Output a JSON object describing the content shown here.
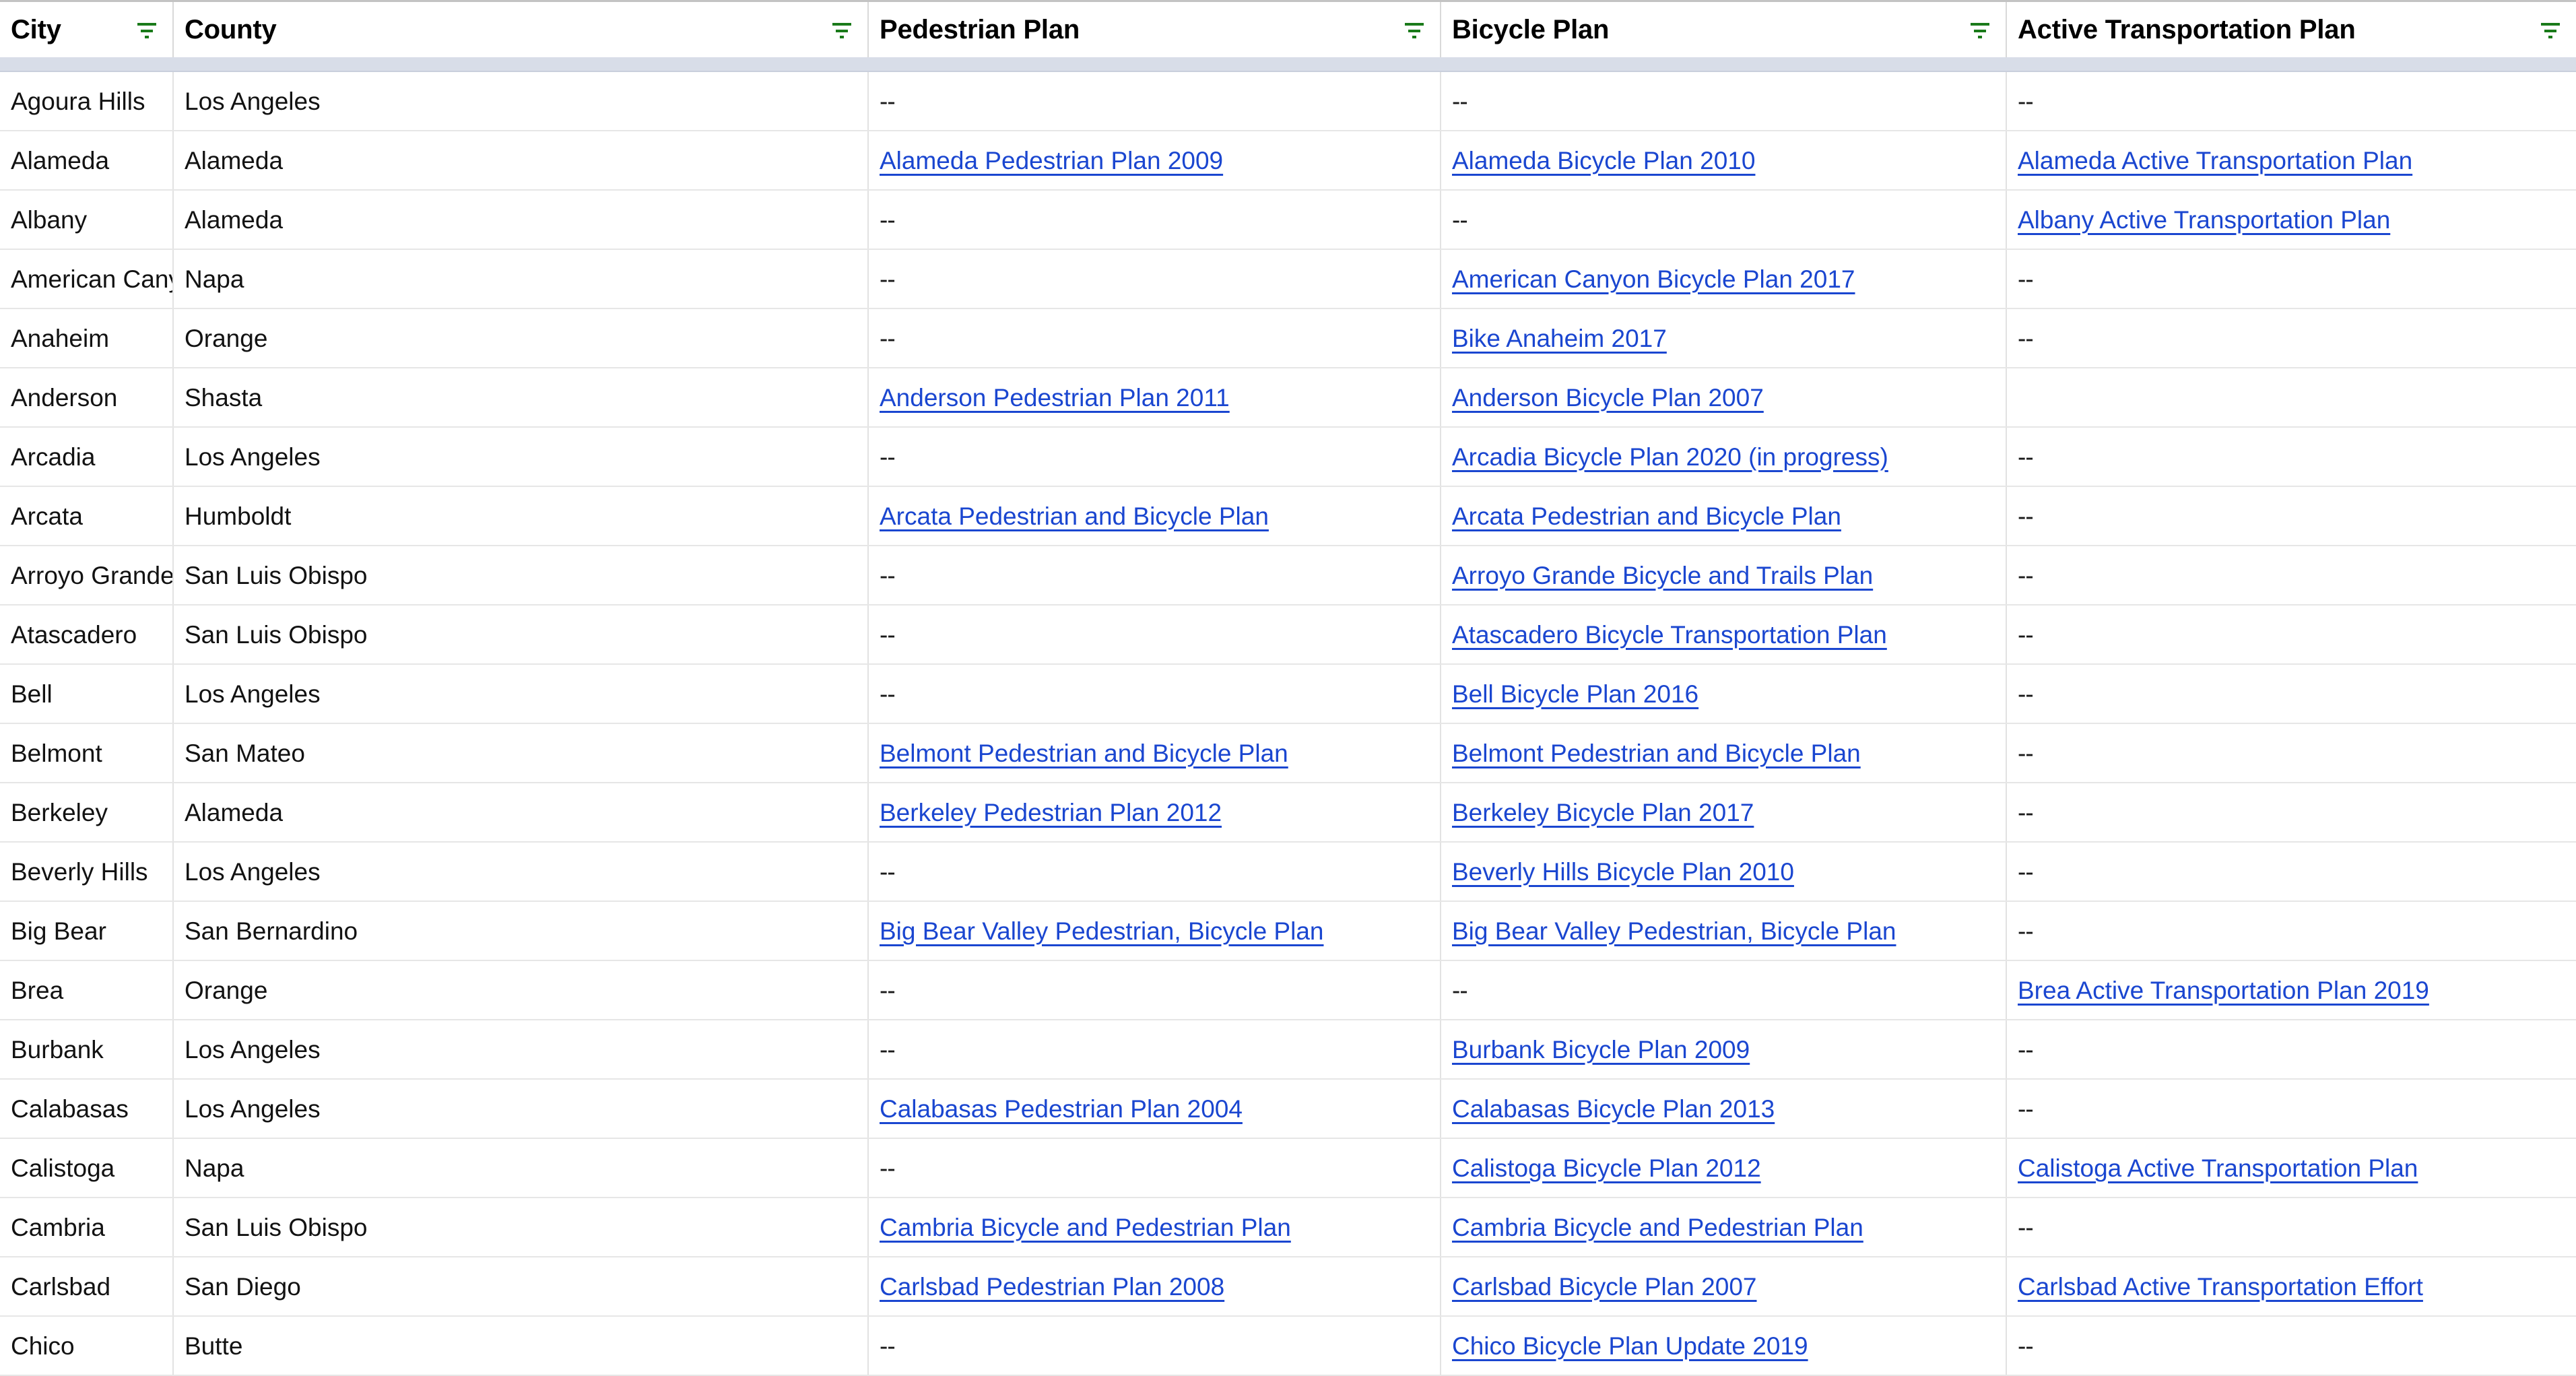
{
  "table": {
    "columns": [
      {
        "key": "city",
        "label": "City",
        "filter_icon": "filter-icon"
      },
      {
        "key": "county",
        "label": "County",
        "filter_icon": "filter-icon"
      },
      {
        "key": "ped",
        "label": "Pedestrian Plan",
        "filter_icon": "filter-icon"
      },
      {
        "key": "bike",
        "label": "Bicycle Plan",
        "filter_icon": "filter-icon"
      },
      {
        "key": "atp",
        "label": "Active Transportation Plan",
        "filter_icon": "filter-icon"
      }
    ],
    "empty_marker": "--",
    "link_color": "#1a46d0",
    "filter_icon_color": "#1a7a1a",
    "header_band_color": "#d8dde8",
    "rows": [
      {
        "city": "Agoura Hills",
        "county": "Los Angeles",
        "ped": {
          "text": "--",
          "link": false
        },
        "bike": {
          "text": "--",
          "link": false
        },
        "atp": {
          "text": "--",
          "link": false
        }
      },
      {
        "city": "Alameda",
        "county": "Alameda",
        "ped": {
          "text": "Alameda Pedestrian Plan 2009",
          "link": true
        },
        "bike": {
          "text": "Alameda Bicycle Plan 2010",
          "link": true
        },
        "atp": {
          "text": "Alameda Active Transportation Plan",
          "link": true
        }
      },
      {
        "city": "Albany",
        "county": "Alameda",
        "ped": {
          "text": "--",
          "link": false
        },
        "bike": {
          "text": "--",
          "link": false
        },
        "atp": {
          "text": "Albany Active Transportation Plan",
          "link": true
        }
      },
      {
        "city": "American Canyon",
        "county": "Napa",
        "ped": {
          "text": "--",
          "link": false
        },
        "bike": {
          "text": "American Canyon Bicycle Plan 2017",
          "link": true
        },
        "atp": {
          "text": "--",
          "link": false
        }
      },
      {
        "city": "Anaheim",
        "county": "Orange",
        "ped": {
          "text": "--",
          "link": false
        },
        "bike": {
          "text": "Bike Anaheim 2017",
          "link": true
        },
        "atp": {
          "text": "--",
          "link": false
        }
      },
      {
        "city": "Anderson",
        "county": "Shasta",
        "ped": {
          "text": "Anderson Pedestrian Plan 2011",
          "link": true
        },
        "bike": {
          "text": "Anderson Bicycle Plan 2007",
          "link": true
        },
        "atp": {
          "text": "",
          "link": false
        }
      },
      {
        "city": "Arcadia",
        "county": "Los Angeles",
        "ped": {
          "text": "--",
          "link": false
        },
        "bike": {
          "text": "Arcadia Bicycle Plan 2020 (in progress)",
          "link": true
        },
        "atp": {
          "text": "--",
          "link": false
        }
      },
      {
        "city": "Arcata",
        "county": "Humboldt",
        "ped": {
          "text": "Arcata Pedestrian and Bicycle Plan",
          "link": true
        },
        "bike": {
          "text": "Arcata Pedestrian and Bicycle Plan",
          "link": true
        },
        "atp": {
          "text": "--",
          "link": false
        }
      },
      {
        "city": "Arroyo Grande",
        "county": "San Luis Obispo",
        "ped": {
          "text": "--",
          "link": false
        },
        "bike": {
          "text": "Arroyo Grande Bicycle and Trails Plan",
          "link": true
        },
        "atp": {
          "text": "--",
          "link": false
        }
      },
      {
        "city": "Atascadero",
        "county": "San Luis Obispo",
        "ped": {
          "text": "--",
          "link": false
        },
        "bike": {
          "text": "Atascadero Bicycle Transportation Plan",
          "link": true
        },
        "atp": {
          "text": "--",
          "link": false
        }
      },
      {
        "city": "Bell",
        "county": "Los Angeles",
        "ped": {
          "text": "--",
          "link": false
        },
        "bike": {
          "text": "Bell Bicycle Plan 2016",
          "link": true
        },
        "atp": {
          "text": "--",
          "link": false
        }
      },
      {
        "city": "Belmont",
        "county": "San Mateo",
        "ped": {
          "text": "Belmont Pedestrian and Bicycle Plan",
          "link": true
        },
        "bike": {
          "text": "Belmont Pedestrian and Bicycle Plan",
          "link": true
        },
        "atp": {
          "text": "--",
          "link": false
        }
      },
      {
        "city": "Berkeley",
        "county": "Alameda",
        "ped": {
          "text": "Berkeley Pedestrian Plan 2012",
          "link": true
        },
        "bike": {
          "text": "Berkeley Bicycle Plan 2017",
          "link": true
        },
        "atp": {
          "text": "--",
          "link": false
        }
      },
      {
        "city": "Beverly Hills",
        "county": "Los Angeles",
        "ped": {
          "text": "--",
          "link": false
        },
        "bike": {
          "text": "Beverly Hills Bicycle Plan 2010",
          "link": true
        },
        "atp": {
          "text": "--",
          "link": false
        }
      },
      {
        "city": "Big Bear",
        "county": "San Bernardino",
        "ped": {
          "text": "Big Bear Valley Pedestrian, Bicycle Plan",
          "link": true
        },
        "bike": {
          "text": "Big Bear Valley Pedestrian, Bicycle Plan",
          "link": true
        },
        "atp": {
          "text": "--",
          "link": false
        }
      },
      {
        "city": "Brea",
        "county": "Orange",
        "ped": {
          "text": "--",
          "link": false
        },
        "bike": {
          "text": "--",
          "link": false
        },
        "atp": {
          "text": "Brea Active Transportation Plan 2019",
          "link": true
        }
      },
      {
        "city": "Burbank",
        "county": "Los Angeles",
        "ped": {
          "text": "--",
          "link": false
        },
        "bike": {
          "text": "Burbank Bicycle Plan 2009",
          "link": true
        },
        "atp": {
          "text": "--",
          "link": false
        }
      },
      {
        "city": "Calabasas",
        "county": "Los Angeles",
        "ped": {
          "text": "Calabasas Pedestrian Plan 2004",
          "link": true
        },
        "bike": {
          "text": "Calabasas Bicycle Plan 2013",
          "link": true
        },
        "atp": {
          "text": "--",
          "link": false
        }
      },
      {
        "city": "Calistoga",
        "county": "Napa",
        "ped": {
          "text": "--",
          "link": false
        },
        "bike": {
          "text": "Calistoga Bicycle Plan 2012",
          "link": true
        },
        "atp": {
          "text": "Calistoga Active Transportation Plan",
          "link": true
        }
      },
      {
        "city": "Cambria",
        "county": "San Luis Obispo",
        "ped": {
          "text": "Cambria Bicycle and Pedestrian Plan",
          "link": true
        },
        "bike": {
          "text": "Cambria Bicycle and Pedestrian Plan",
          "link": true
        },
        "atp": {
          "text": "--",
          "link": false
        }
      },
      {
        "city": "Carlsbad",
        "county": "San Diego",
        "ped": {
          "text": "Carlsbad Pedestrian Plan 2008",
          "link": true
        },
        "bike": {
          "text": "Carlsbad Bicycle Plan 2007",
          "link": true
        },
        "atp": {
          "text": "Carlsbad Active Transportation Effort",
          "link": true
        }
      },
      {
        "city": "Chico",
        "county": "Butte",
        "ped": {
          "text": "--",
          "link": false
        },
        "bike": {
          "text": "Chico Bicycle Plan Update 2019",
          "link": true
        },
        "atp": {
          "text": "--",
          "link": false
        }
      }
    ]
  }
}
